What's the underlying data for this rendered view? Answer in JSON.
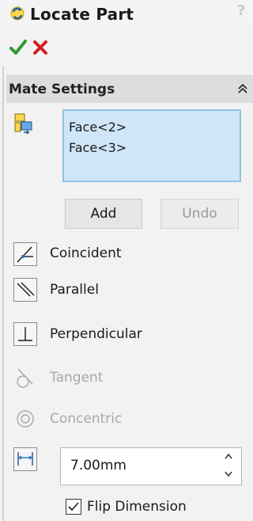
{
  "window": {
    "title": "Locate Part",
    "help_label": "?"
  },
  "actions": {
    "ok_icon": "green-checkmark-icon",
    "cancel_icon": "red-x-icon"
  },
  "mate_settings": {
    "title": "Mate Settings",
    "selections": [
      "Face<2>",
      "Face<3>"
    ],
    "add_label": "Add",
    "undo_label": "Undo",
    "mates": [
      {
        "label": "Coincident",
        "icon": "coincident-icon",
        "enabled": true
      },
      {
        "label": "Parallel",
        "icon": "parallel-icon",
        "enabled": true
      },
      {
        "label": "Perpendicular",
        "icon": "perpendicular-icon",
        "enabled": true
      },
      {
        "label": "Tangent",
        "icon": "tangent-icon",
        "enabled": false
      },
      {
        "label": "Concentric",
        "icon": "concentric-icon",
        "enabled": false
      }
    ],
    "distance_value": "7.00mm",
    "flip_dimension_label": "Flip Dimension",
    "flip_dimension_checked": true
  },
  "colors": {
    "selection_bg": "#cfe6f8",
    "selection_border": "#8cc4ec",
    "ok_green": "#2e9b2e",
    "cancel_red": "#d21f1f"
  }
}
